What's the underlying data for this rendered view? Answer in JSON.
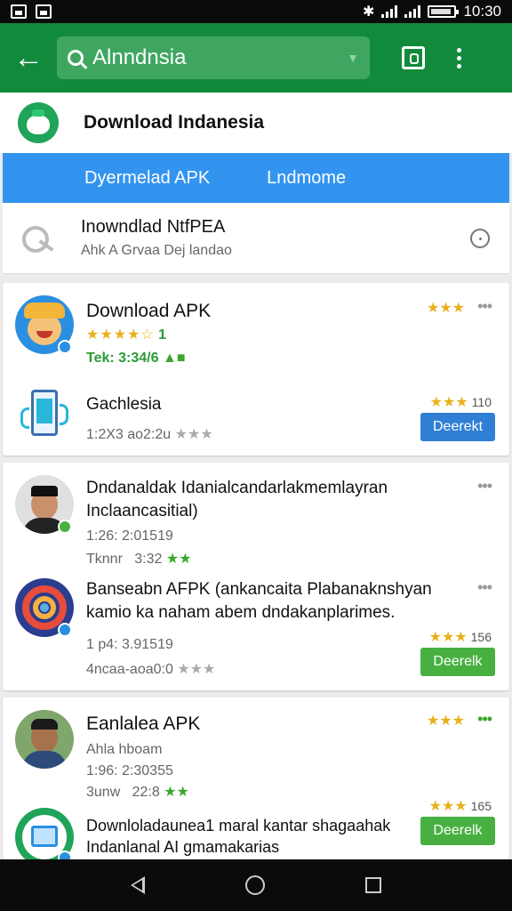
{
  "status": {
    "time": "10:30"
  },
  "search": {
    "value": "Alnndnsia"
  },
  "header": {
    "title": "Download Indanesia"
  },
  "tabs": [
    "Dyermelad APK",
    "Lndmome"
  ],
  "banner": {
    "title": "Inowndlad NtfPEA",
    "subtitle": "Ahk A Grvaa Dej landao"
  },
  "apps": [
    {
      "name": "Download APK",
      "rating_stars": "★★★★☆",
      "rating_num": "1",
      "meta": "Tek: 3:34/6",
      "right_stars": "★★★",
      "menu": "•••"
    },
    {
      "name": "Gachlesia",
      "meta": "1:2X3 ao2:2u",
      "right_stars": "★★★",
      "right_num": "110",
      "button": "Deerekt"
    },
    {
      "name_line1": "Dndanaldak Idanialcandarlakmemlayran",
      "name_line2": "Inclaancasitial)",
      "meta1": "1:26: 2:01519",
      "meta2": "Tknnr",
      "meta2_num": "3:32",
      "menu": "•••"
    },
    {
      "name_line1": "Banseabn AFPK (ankancaita Plabanaknshyan",
      "name_line2": "kamio ka naham abem dndakanplarimes.",
      "meta1": "1 p4: 3.91519",
      "meta2": "4ncaa-aoa0:0",
      "right_stars": "★★★",
      "right_num": "156",
      "button": "Deerelk",
      "menu": "•••"
    },
    {
      "name": "Eanlalea APK",
      "meta1": "Ahla hboam",
      "meta2": "1:96: 2:30355",
      "meta3": "3unw",
      "meta3_num": "22:8",
      "right_stars": "★★★",
      "right_num": "165",
      "button": "Deerelk",
      "top_stars": "★★★"
    },
    {
      "name_line1": "Downloladaunea1 maral kantar shagaahak",
      "name_line2": "Indanlanal AI gmamakarias"
    }
  ],
  "colors": {
    "appbar": "#128a3c",
    "tabs": "#3394f0",
    "button_blue": "#2f7fd6",
    "button_green": "#47b041",
    "star": "#e8b11a"
  }
}
